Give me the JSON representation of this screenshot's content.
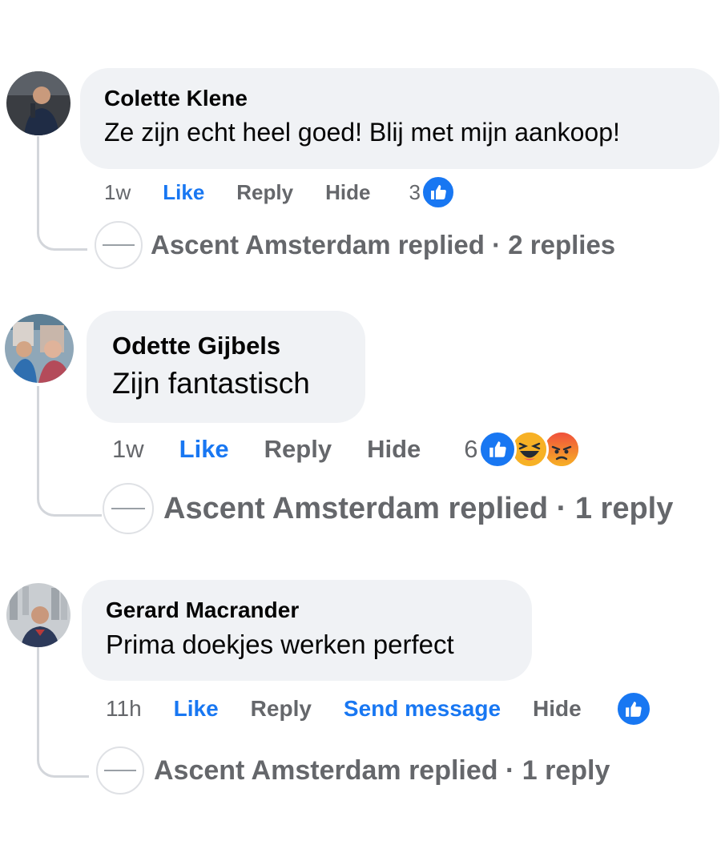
{
  "colors": {
    "like_blue": "#1877f2",
    "muted_gray": "#65676b",
    "bubble_bg": "#f0f2f5",
    "haha_yellow": "#f7b125",
    "angry_orange": "#e9710f"
  },
  "comments": [
    {
      "author": "Colette Klene",
      "text": "Ze zijn echt heel goed! Blij met mijn aankoop!",
      "time": "1w",
      "like_label": "Like",
      "reply_label": "Reply",
      "hide_label": "Hide",
      "reaction_count": "3",
      "reactions": [
        "like-icon"
      ],
      "replies_summary": "Ascent Amsterdam replied · 2 replies"
    },
    {
      "author": "Odette Gijbels",
      "text": "Zijn fantastisch",
      "time": "1w",
      "like_label": "Like",
      "reply_label": "Reply",
      "hide_label": "Hide",
      "reaction_count": "6",
      "reactions": [
        "like-icon",
        "haha-icon",
        "angry-icon"
      ],
      "replies_summary": "Ascent Amsterdam replied · 1 reply"
    },
    {
      "author": "Gerard Macrander",
      "text": "Prima doekjes werken perfect",
      "time": "11h",
      "like_label": "Like",
      "reply_label": "Reply",
      "send_message_label": "Send message",
      "hide_label": "Hide",
      "reactions": [
        "like-icon"
      ],
      "replies_summary": "Ascent Amsterdam replied · 1 reply"
    }
  ]
}
